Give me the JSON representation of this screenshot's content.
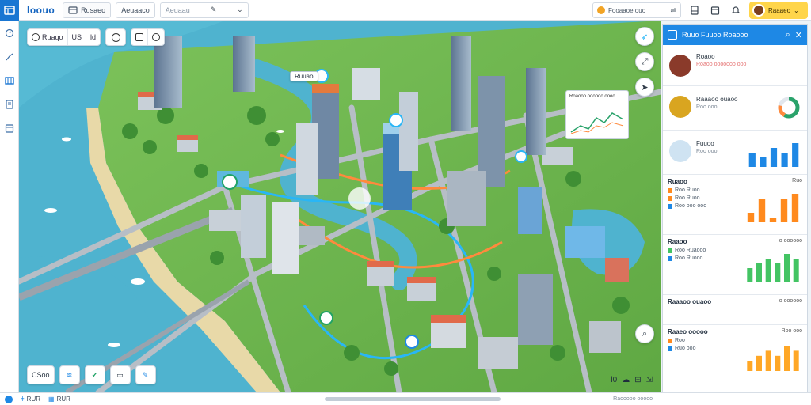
{
  "app": {
    "title": "loouo",
    "logo_icon": "map-logo-icon"
  },
  "toolbar": {
    "menu_label": "Rusaeo",
    "field1": "Aeuaaco",
    "field2": "Aeuaau",
    "search_label": "Fooaaoe ouo"
  },
  "user": {
    "name": "Raaaeo"
  },
  "map": {
    "toolbar": {
      "view_label": "Ruaqo",
      "seg2": "US",
      "seg3": "ld"
    },
    "label_tower": "Ruuao",
    "card_title": "Roaooo oooooo oooo",
    "bottom_tools": [
      "CSoo",
      "",
      "",
      "",
      ""
    ],
    "bottom_right_tools": [
      "l0",
      "",
      "",
      ""
    ]
  },
  "panel": {
    "title": "Ruuo Fuuoo Roaooo",
    "contacts": [
      {
        "name": "Roaoo",
        "sub": "Roaoo ooooooo ooo",
        "meta": ""
      },
      {
        "name": "Raaaoo ouaoo",
        "sub": "",
        "meta": "Roo ooo"
      },
      {
        "name": "Fuuoo",
        "sub": "",
        "meta": "Roo ooo"
      }
    ],
    "sections": [
      {
        "title": "Ruaoo",
        "right": "Ruo",
        "rows": [
          "Roo Ruoo",
          "Roo Ruoo",
          "Roo ooo ooo"
        ]
      },
      {
        "title": "Raaoo",
        "right": "o oooooo",
        "rows": [
          "Roo Ruaooo",
          "Roo Ruooo"
        ]
      },
      {
        "title": "Raaaoo ouaoo",
        "right": "o oooooo",
        "rows": []
      },
      {
        "title": "Raaeo ooooo",
        "right": "Roo ooo",
        "rows": [
          "Roo",
          "Ruo ooo"
        ]
      }
    ]
  },
  "status": {
    "item1": "RUR",
    "item2": "RUR",
    "right": "Raooooo ooooo"
  },
  "colors": {
    "accent": "#1e88e5",
    "water": "#4fb3cf",
    "route_blue": "#29b6f6",
    "route_orange": "#ff8a3d",
    "bar_orange": "#ff8a1e",
    "bar_blue": "#1e88e5",
    "bar_green": "#43c463"
  },
  "chart_data": [
    {
      "type": "bar",
      "categories": [
        "1",
        "2",
        "3",
        "4",
        "5"
      ],
      "series": [
        {
          "values": [
            3,
            2,
            4,
            3,
            5
          ]
        }
      ]
    },
    {
      "type": "bar",
      "categories": [
        "1",
        "2",
        "3",
        "4",
        "5"
      ],
      "series": [
        {
          "values": [
            2,
            5,
            1,
            5,
            6
          ]
        }
      ]
    },
    {
      "type": "bar",
      "categories": [
        "1",
        "2",
        "3",
        "4",
        "5",
        "6"
      ],
      "series": [
        {
          "values": [
            3,
            4,
            5,
            4,
            6,
            5
          ]
        }
      ]
    },
    {
      "type": "bar",
      "categories": [
        "1",
        "2",
        "3",
        "4",
        "5",
        "6"
      ],
      "series": [
        {
          "values": [
            2,
            3,
            4,
            3,
            5,
            4
          ]
        }
      ]
    }
  ]
}
